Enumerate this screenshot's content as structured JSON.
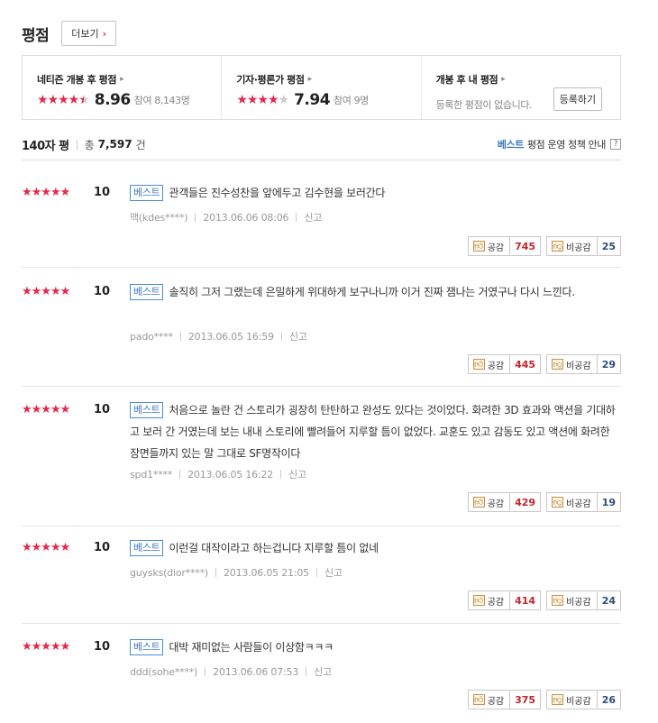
{
  "header": {
    "title": "평점",
    "more_label": "더보기"
  },
  "scores": [
    {
      "title": "네티즌 개봉 후 평점",
      "stars": 4.5,
      "score": "8.96",
      "participants": "참여 8,143명"
    },
    {
      "title": "기자·평론가 평점",
      "stars": 4,
      "score": "7.94",
      "participants": "참여 9명"
    },
    {
      "title": "개봉 후 내 평점",
      "empty_text": "등록한 평점이 없습니다.",
      "register_label": "등록하기"
    }
  ],
  "list": {
    "tab_label": "140자 평",
    "total_label": "총",
    "total_count": "7,597",
    "total_unit": "건",
    "policy_best": "베스트",
    "policy_label": "평점 운영 정책 안내",
    "help_icon": "?"
  },
  "colors": {
    "accent": "#e5284b",
    "best_blue": "#3c78c3"
  },
  "reviews": [
    {
      "stars": 5,
      "score": "10",
      "badge": "베스트",
      "text": "관객들은 진수성찬을 앞에두고 김수현을 보러간다",
      "author": "맥(kdes****)",
      "date": "2013.06.06 08:06",
      "report": "신고",
      "like_label": "공감",
      "likes": "745",
      "dislike_label": "비공감",
      "dislikes": "25",
      "like_icon": "thumbs-up-icon",
      "dislike_icon": "thumbs-down-icon"
    },
    {
      "stars": 5,
      "score": "10",
      "badge": "베스트",
      "text": "솔직히 그저 그랬는데 은밀하게 위대하게 보구나니까 이거 진짜 잼나는 거였구나 다시 느낀다.",
      "author": "pado****",
      "date": "2013.06.05 16:59",
      "report": "신고",
      "like_label": "공감",
      "likes": "445",
      "dislike_label": "비공감",
      "dislikes": "29",
      "like_icon": "thumbs-up-icon",
      "dislike_icon": "thumbs-down-icon"
    },
    {
      "stars": 5,
      "score": "10",
      "badge": "베스트",
      "text": "처음으로 놀란 건 스토리가 굉장히 탄탄하고 완성도 있다는 것이었다. 화려한 3D 효과와 액션을 기대하고 보러 간 거였는데 보는 내내 스토리에 빨려들어 지루할 틈이 없었다. 교훈도 있고 감동도 있고 액션에 화려한 장면들까지 있는 말 그대로 SF명작이다",
      "author": "spd1****",
      "date": "2013.06.05 16:22",
      "report": "신고",
      "like_label": "공감",
      "likes": "429",
      "dislike_label": "비공감",
      "dislikes": "19",
      "like_icon": "thumbs-up-icon",
      "dislike_icon": "thumbs-down-icon"
    },
    {
      "stars": 5,
      "score": "10",
      "badge": "베스트",
      "text": "이런걸 대작이라고 하는겁니다 지루할 틈이 없네",
      "author": "guysks(dior****)",
      "date": "2013.06.05 21:05",
      "report": "신고",
      "like_label": "공감",
      "likes": "414",
      "dislike_label": "비공감",
      "dislikes": "24",
      "like_icon": "thumbs-up-icon",
      "dislike_icon": "thumbs-down-icon"
    },
    {
      "stars": 5,
      "score": "10",
      "badge": "베스트",
      "text": "대박 재미없는 사람들이 이상함ㅋㅋㅋ",
      "author": "ddd(sohe****)",
      "date": "2013.06.06 07:53",
      "report": "신고",
      "like_label": "공감",
      "likes": "375",
      "dislike_label": "비공감",
      "dislikes": "26",
      "like_icon": "thumbs-up-icon",
      "dislike_icon": "thumbs-down-icon"
    }
  ]
}
